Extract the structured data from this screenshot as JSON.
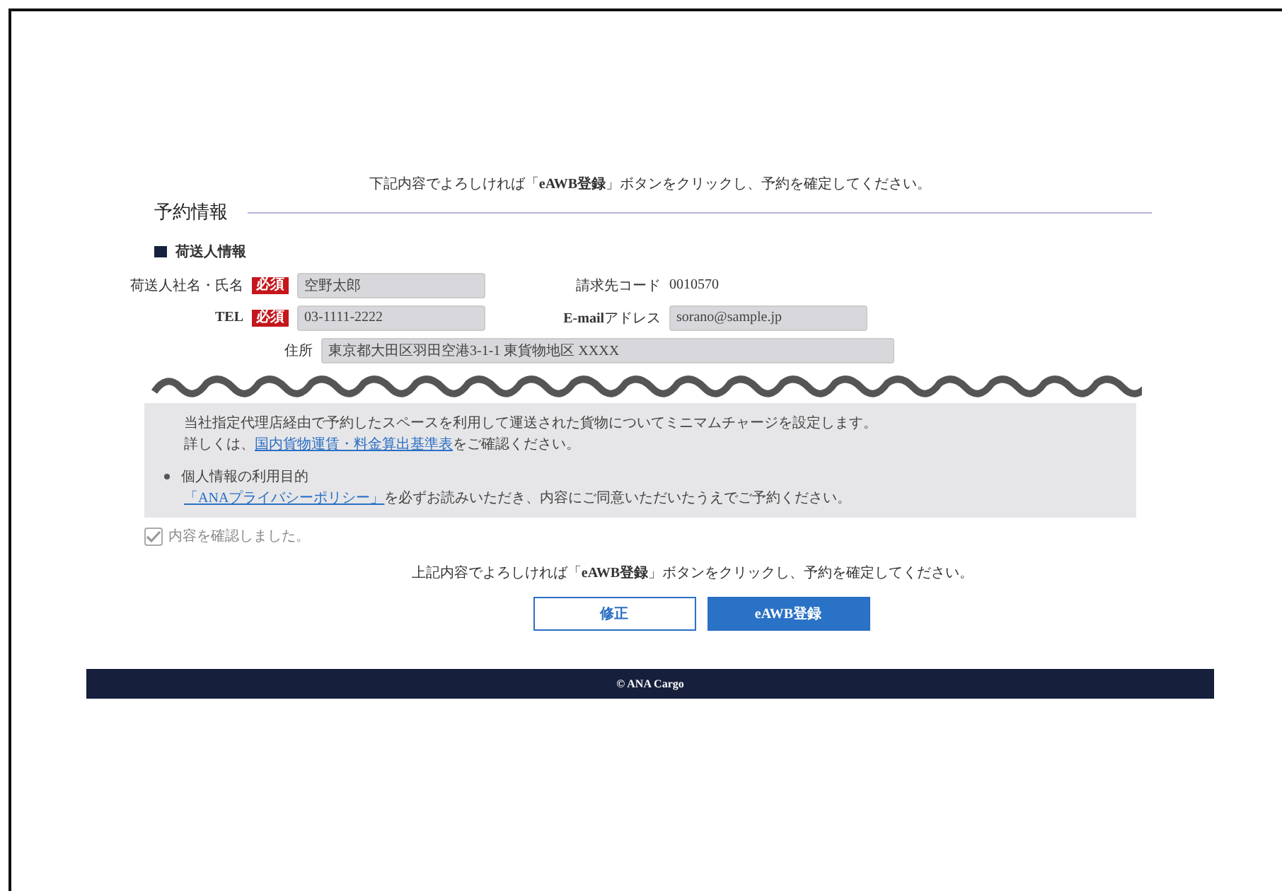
{
  "top_instruction": "下記内容でよろしければ「**eAWB登録**」ボタンをクリックし、予約を確定してください。",
  "section_title": "予約情報",
  "subsection_title": "荷送人情報",
  "form_rows": [
    {
      "fields": [
        {
          "label": "荷送人社名・氏名",
          "required_badge": "必須",
          "kind": "input",
          "value": "空野太郎"
        },
        {
          "label": "請求先コード",
          "kind": "text",
          "value": "0010570"
        }
      ]
    },
    {
      "fields": [
        {
          "label": "**TEL**",
          "required_badge": "必須",
          "kind": "input",
          "value": "03-1111-2222"
        },
        {
          "label": "**E-mail**アドレス",
          "kind": "input",
          "value": "sorano@sample.jp"
        }
      ]
    },
    {
      "fields": [
        {
          "label": "住所",
          "kind": "wide_input",
          "value": "東京都大田区羽田空港3-1-1 東貨物地区 XXXX"
        }
      ]
    }
  ],
  "notes": [
    {
      "paragraphs": [
        {
          "text": "当社指定代理店経由で予約したスペースを利用して運送された貨物についてミニマムチャージを設定します。"
        },
        {
          "prefix": "詳しくは、",
          "link": "国内貨物運賃・料金算出基準表",
          "suffix": "をご確認ください。"
        }
      ]
    },
    {
      "title": "個人情報の利用目的",
      "paragraphs": [
        {
          "link": "「ANAプライバシーポリシー」",
          "suffix": "を必ずお読みいただき、内容にご同意いただいたうえでご予約ください。"
        }
      ]
    }
  ],
  "confirm_checkbox": {
    "label": "内容を確認しました。",
    "checked": true,
    "disabled": true
  },
  "bottom_instruction": "上記内容でよろしければ「**eAWB登録**」ボタンをクリックし、予約を確定してください。",
  "buttons": [
    {
      "label": "修正",
      "kind": "secondary"
    },
    {
      "label": "eAWB登録",
      "kind": "primary"
    }
  ],
  "footer": "© ANA Cargo"
}
